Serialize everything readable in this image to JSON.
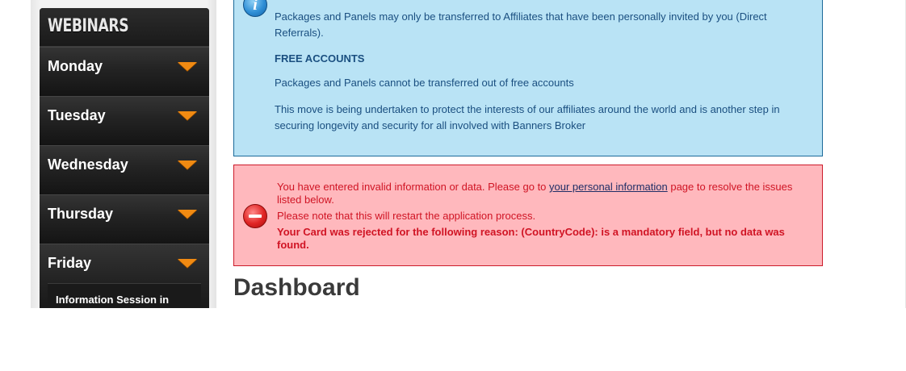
{
  "sidebar": {
    "title": "WEBINARS",
    "days": [
      {
        "label": "Monday"
      },
      {
        "label": "Tuesday"
      },
      {
        "label": "Wednesday"
      },
      {
        "label": "Thursday"
      },
      {
        "label": "Friday",
        "subitem": "Information Session in"
      }
    ]
  },
  "info": {
    "icon": "info-icon",
    "transfer_rule": "Packages and Panels may only be transferred to Affiliates that have been personally invited by you (Direct Referrals).",
    "free_heading": "FREE ACCOUNTS",
    "free_rule": "Packages and Panels cannot be transferred out of free accounts",
    "protection_note": "This move is being undertaken to protect the interests of our affiliates around the world and is another step in securing longevity and security for all involved with Banners Broker"
  },
  "error": {
    "icon": "error-minus-icon",
    "message_before_link": "You have entered invalid information or data. Please go to ",
    "link_text": "your personal information",
    "message_after_link": " page to resolve the issues listed below.",
    "restart_note": "Please note that this will restart the application process.",
    "card_rejection": "Your Card was rejected for the following reason: (CountryCode): is a mandatory field, but no data was found."
  },
  "main": {
    "title": "Dashboard"
  },
  "colors": {
    "accent_arrow": "#f08a12",
    "info_bg": "#b9e3f5",
    "error_bg": "#ffb8bd",
    "error_text": "#d01424"
  }
}
